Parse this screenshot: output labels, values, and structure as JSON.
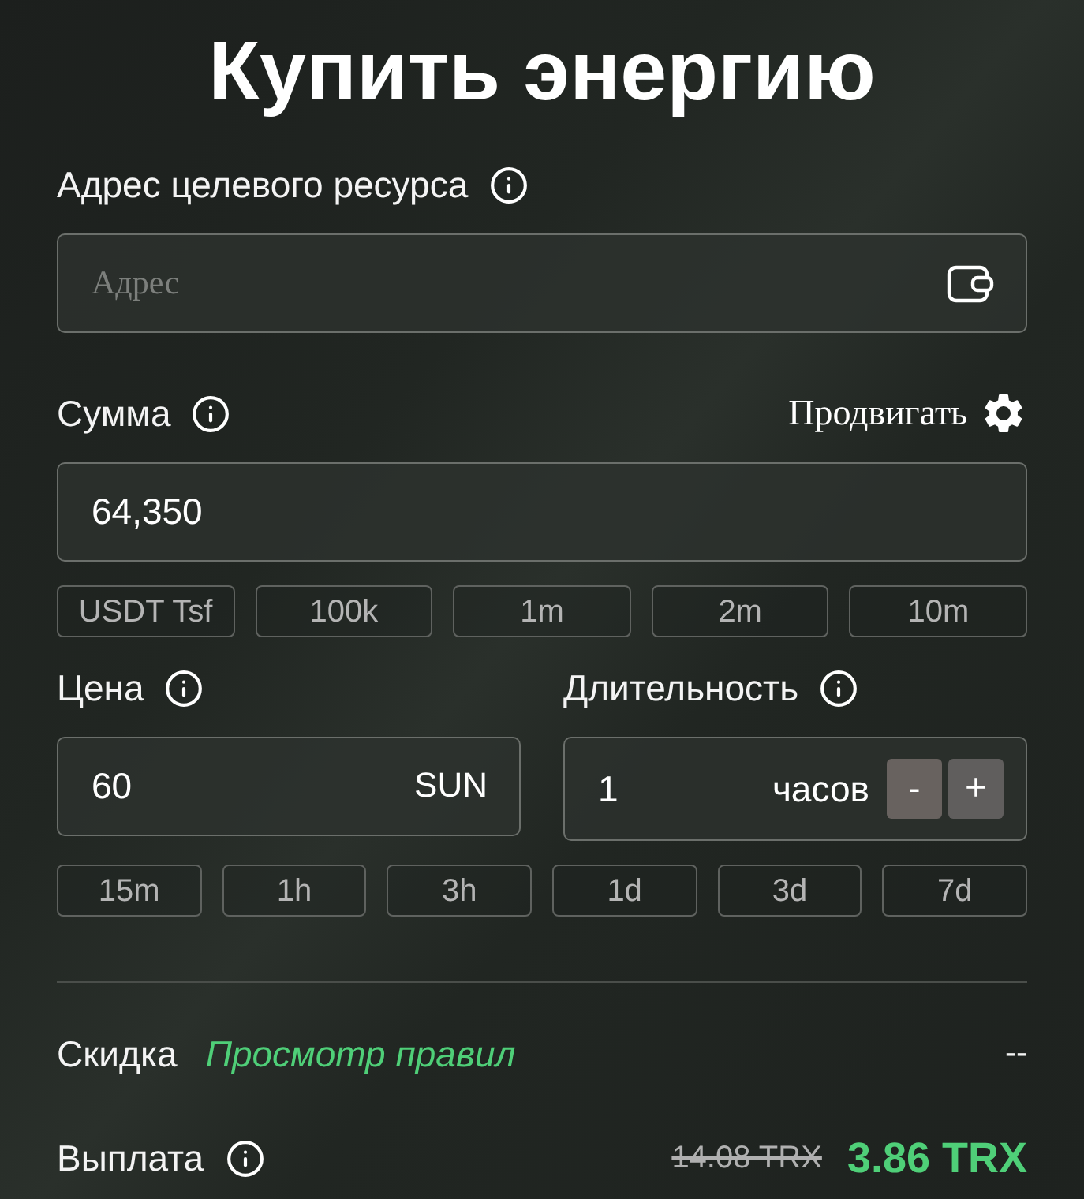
{
  "title": "Купить энергию",
  "address": {
    "label": "Адрес целевого ресурса",
    "placeholder": "Адрес"
  },
  "amount": {
    "label": "Сумма",
    "advanced": "Продвигать",
    "value": "64,350",
    "presets": [
      "USDT Tsf",
      "100k",
      "1m",
      "2m",
      "10m"
    ]
  },
  "price": {
    "label": "Цена",
    "value": "60",
    "unit": "SUN"
  },
  "duration": {
    "label": "Длительность",
    "value": "1",
    "unit": "часов",
    "decrement": "-",
    "increment": "+",
    "presets": [
      "15m",
      "1h",
      "3h",
      "1d",
      "3d",
      "7d"
    ]
  },
  "discount": {
    "label": "Скидка",
    "link": "Просмотр правил",
    "value": "--"
  },
  "payout": {
    "label": "Выплата",
    "old_price": "14.08 TRX",
    "price": "3.86 TRX"
  }
}
